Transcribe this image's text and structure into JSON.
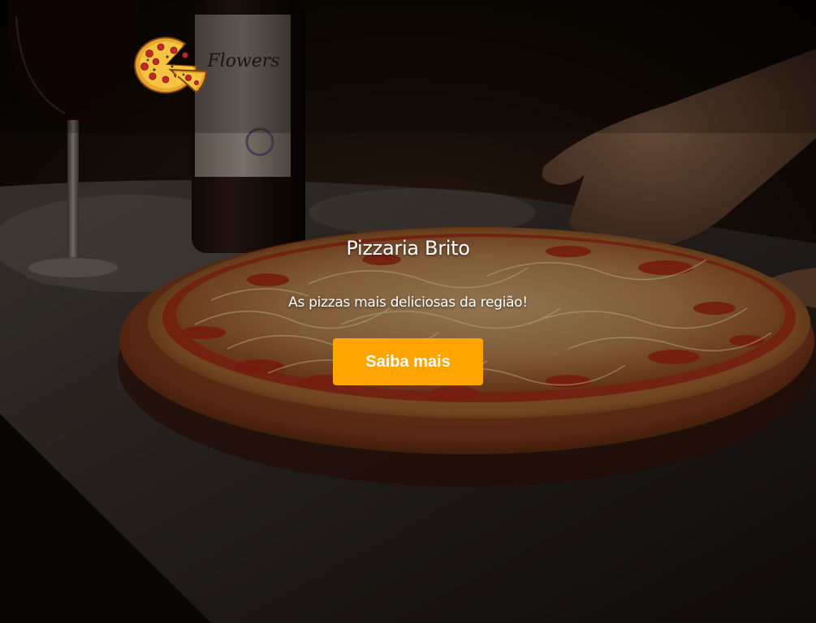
{
  "header": {
    "logo_icon": "pizza-slice-logo-icon"
  },
  "hero": {
    "title": "Pizzaria Brito",
    "subtitle": "As pizzas mais deliciosas da região!",
    "cta_label": "Saiba mais"
  },
  "colors": {
    "cta_background": "#ffa500",
    "text": "#ffffff",
    "overlay": "#000000"
  }
}
